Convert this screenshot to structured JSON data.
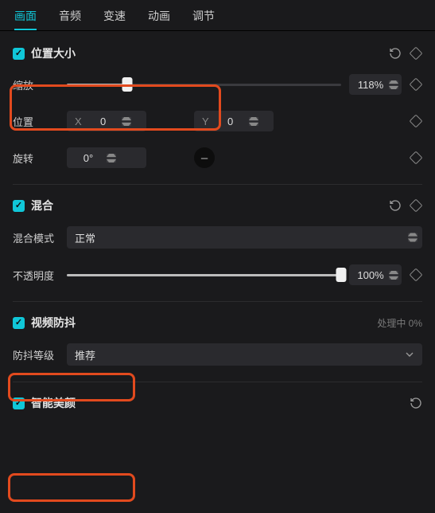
{
  "tabs": {
    "picture": "画面",
    "audio": "音频",
    "speed": "变速",
    "animation": "动画",
    "adjust": "调节"
  },
  "position_size": {
    "title": "位置大小",
    "scale_label": "缩放",
    "scale_value": "118%",
    "position_label": "位置",
    "x_prefix": "X",
    "x_value": "0",
    "y_prefix": "Y",
    "y_value": "0",
    "rotation_label": "旋转",
    "rotation_value": "0°",
    "swatch_glyph": "–"
  },
  "blend": {
    "title": "混合",
    "mode_label": "混合模式",
    "mode_value": "正常",
    "opacity_label": "不透明度",
    "opacity_value": "100%"
  },
  "stabilize": {
    "title": "视频防抖",
    "status": "处理中 0%",
    "level_label": "防抖等级",
    "level_value": "推荐"
  },
  "beauty": {
    "title": "智能美颜"
  }
}
